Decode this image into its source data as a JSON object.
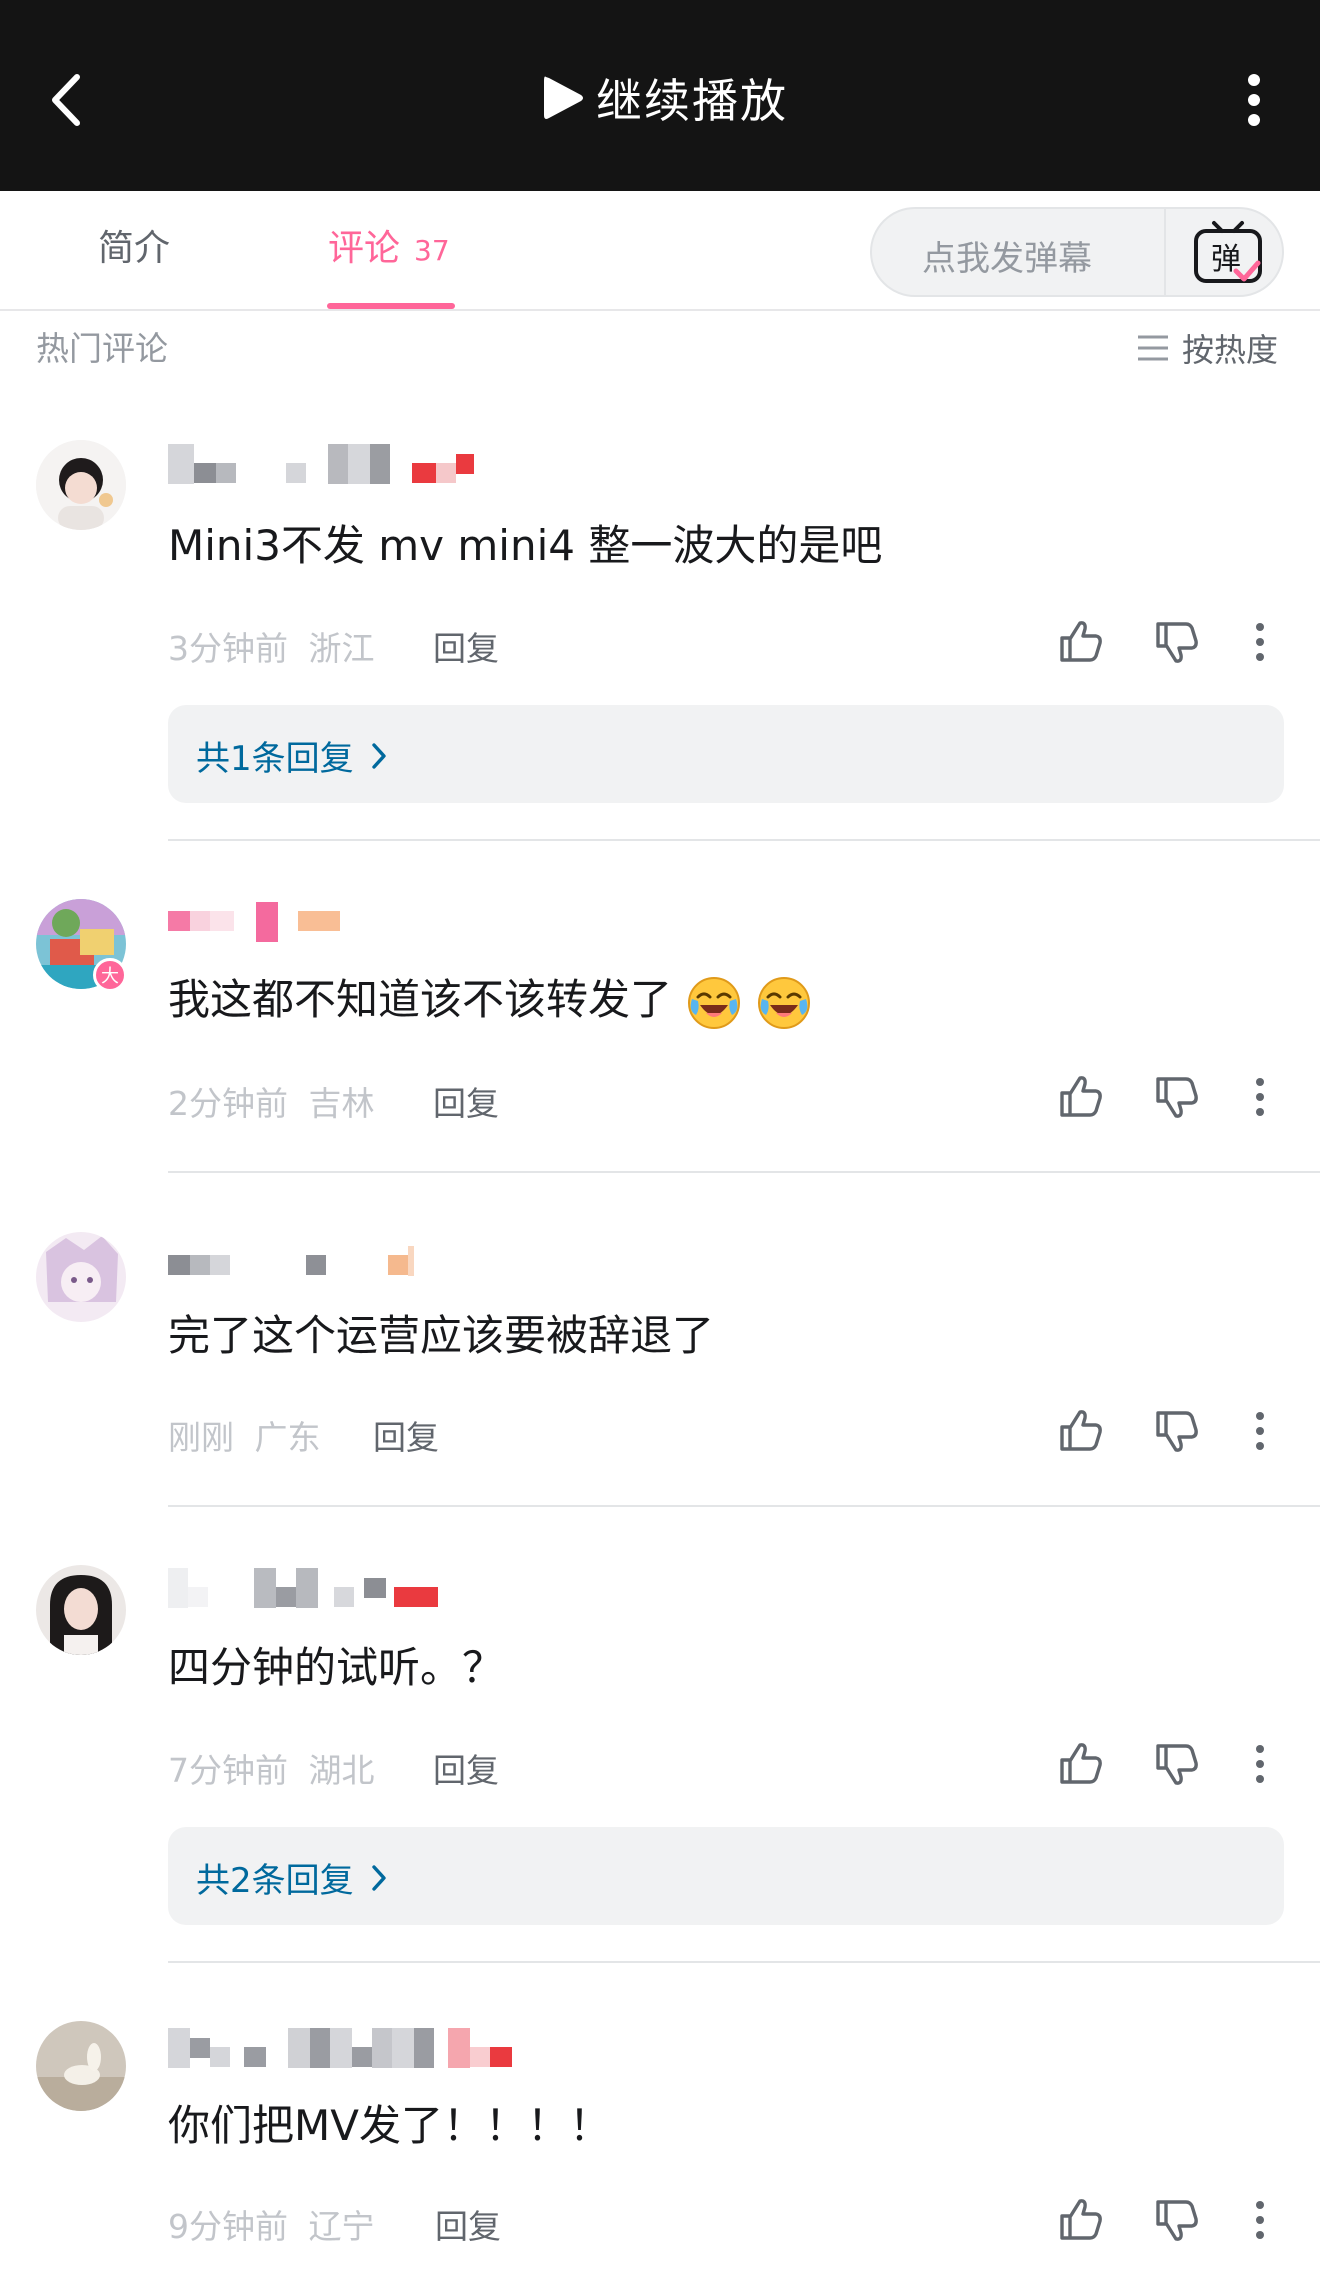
{
  "topbar": {
    "play_label": "继续播放",
    "back_icon": "chevron-left-icon",
    "more_icon": "vertical-dots-icon"
  },
  "tabs": {
    "intro": "简介",
    "comments": "评论",
    "comments_count": "37",
    "danmaku_placeholder": "点我发弹幕",
    "danmaku_icon_label": "弹"
  },
  "section": {
    "hot_title": "热门评论",
    "sort_label": "按热度"
  },
  "colors": {
    "accent": "#ff6699",
    "link": "#00699d",
    "topbar_bg": "#141414"
  },
  "comments": [
    {
      "text": "Mini3不发 mv mini4 整一波大的是吧",
      "time": "3分钟前",
      "location": "浙江",
      "reply_label": "回复",
      "replies": "共1条回复"
    },
    {
      "text": "我这都不知道该不该转发了",
      "time": "2分钟前",
      "location": "吉林",
      "reply_label": "回复",
      "badge": "大"
    },
    {
      "text": "完了这个运营应该要被辞退了",
      "time": "刚刚",
      "location": "广东",
      "reply_label": "回复"
    },
    {
      "text": "四分钟的试听。？",
      "time": "7分钟前",
      "location": "湖北",
      "reply_label": "回复",
      "replies": "共2条回复"
    },
    {
      "text": "你们把MV发了！！！！",
      "time": "9分钟前",
      "location": "辽宁",
      "reply_label": "回复"
    }
  ]
}
